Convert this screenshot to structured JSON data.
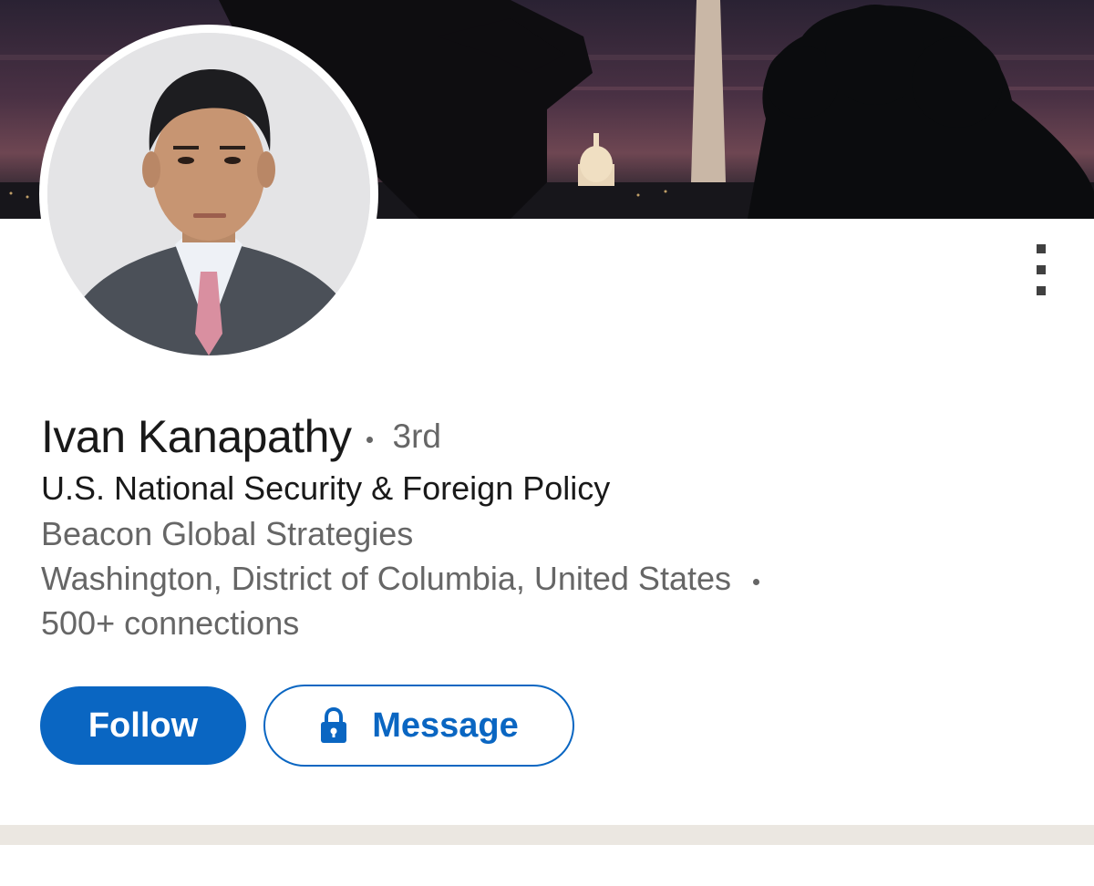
{
  "profile": {
    "name": "Ivan Kanapathy",
    "connection_degree": "3rd",
    "headline": "U.S. National Security & Foreign Policy",
    "company": "Beacon Global Strategies",
    "location": "Washington, District of Columbia, United States",
    "connections": "500+ connections"
  },
  "actions": {
    "follow_label": "Follow",
    "message_label": "Message",
    "message_icon": "lock-icon",
    "more_icon": "more-vertical-icon"
  },
  "colors": {
    "primary": "#0a66c2",
    "text_primary": "#191919",
    "text_secondary": "#666666",
    "divider_band": "#ebe7e1"
  }
}
